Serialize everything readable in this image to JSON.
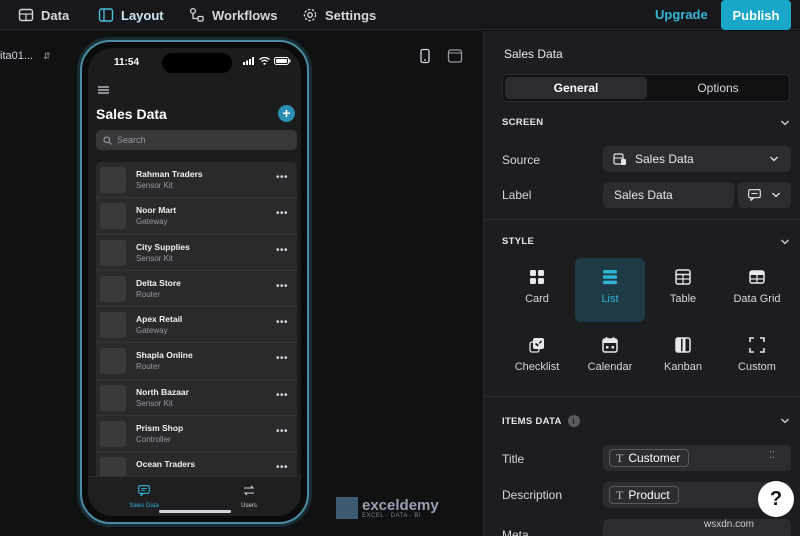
{
  "topbar": {
    "nav": [
      {
        "label": "Data"
      },
      {
        "label": "Layout"
      },
      {
        "label": "Workflows"
      },
      {
        "label": "Settings"
      }
    ],
    "upgrade_label": "Upgrade",
    "publish_label": "Publish"
  },
  "left": {
    "screen_selector": "ita01..."
  },
  "phone": {
    "time": "11:54",
    "title": "Sales Data",
    "search_placeholder": "Search",
    "rows": [
      {
        "title": "Rahman Traders",
        "subtitle": "Sensor Kit"
      },
      {
        "title": "Noor Mart",
        "subtitle": "Gateway"
      },
      {
        "title": "City Supplies",
        "subtitle": "Sensor Kit"
      },
      {
        "title": "Delta Store",
        "subtitle": "Router"
      },
      {
        "title": "Apex Retail",
        "subtitle": "Gateway"
      },
      {
        "title": "Shapla Online",
        "subtitle": "Router"
      },
      {
        "title": "North Bazaar",
        "subtitle": "Sensor Kit"
      },
      {
        "title": "Prism Shop",
        "subtitle": "Controller"
      },
      {
        "title": "Ocean Traders",
        "subtitle": ""
      }
    ],
    "tabs": [
      {
        "label": "Sales Data"
      },
      {
        "label": "Users"
      }
    ]
  },
  "panel": {
    "title": "Sales Data",
    "tabs": {
      "general": "General",
      "options": "Options"
    },
    "screen_section": "SCREEN",
    "source_label": "Source",
    "source_value": "Sales Data",
    "label_label": "Label",
    "label_value": "Sales Data",
    "style_section": "STYLE",
    "styles": [
      {
        "name": "Card"
      },
      {
        "name": "List"
      },
      {
        "name": "Table"
      },
      {
        "name": "Data Grid"
      },
      {
        "name": "Checklist"
      },
      {
        "name": "Calendar"
      },
      {
        "name": "Kanban"
      },
      {
        "name": "Custom"
      }
    ],
    "items_section": "ITEMS DATA",
    "title_label": "Title",
    "title_value": "Customer",
    "description_label": "Description",
    "description_value": "Product",
    "meta_label": "Meta"
  },
  "watermark": {
    "brand": "exceldemy",
    "tagline": "EXCEL · DATA · BI",
    "site": "wsxdn.com"
  },
  "colors": {
    "accent": "#18a7c9",
    "panel_bg": "#1c1d20",
    "canvas_bg": "#101113"
  }
}
